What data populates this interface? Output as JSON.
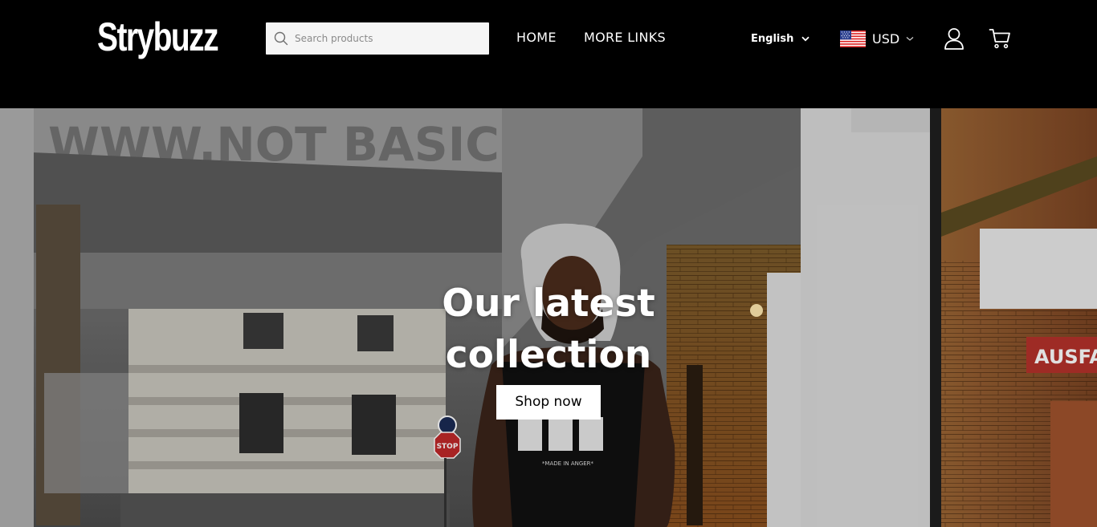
{
  "brand": {
    "name": "Strybuzz"
  },
  "search": {
    "placeholder": "Search products"
  },
  "nav": [
    {
      "label": "HOME"
    },
    {
      "label": "MORE LINKS"
    }
  ],
  "language": {
    "selected": "English"
  },
  "currency": {
    "selected": "USD",
    "flag": "us-flag-icon"
  },
  "icons": {
    "account": "user-icon",
    "cart": "cart-icon",
    "search": "search-icon",
    "chevron": "chevron-down-icon"
  },
  "hero": {
    "title": "Our latest collection",
    "button": "Shop now",
    "image": "Man in a fur trapper hat and black tank top standing in an urban alley",
    "signs": {
      "stop": "STOP",
      "shop": "AUSFAH",
      "shirt": "*MADE IN ANGER*"
    }
  },
  "colors": {
    "header_bg": "#000000",
    "button_bg": "#ffffff",
    "button_text": "#000000",
    "search_bg": "#f5f5f5"
  }
}
